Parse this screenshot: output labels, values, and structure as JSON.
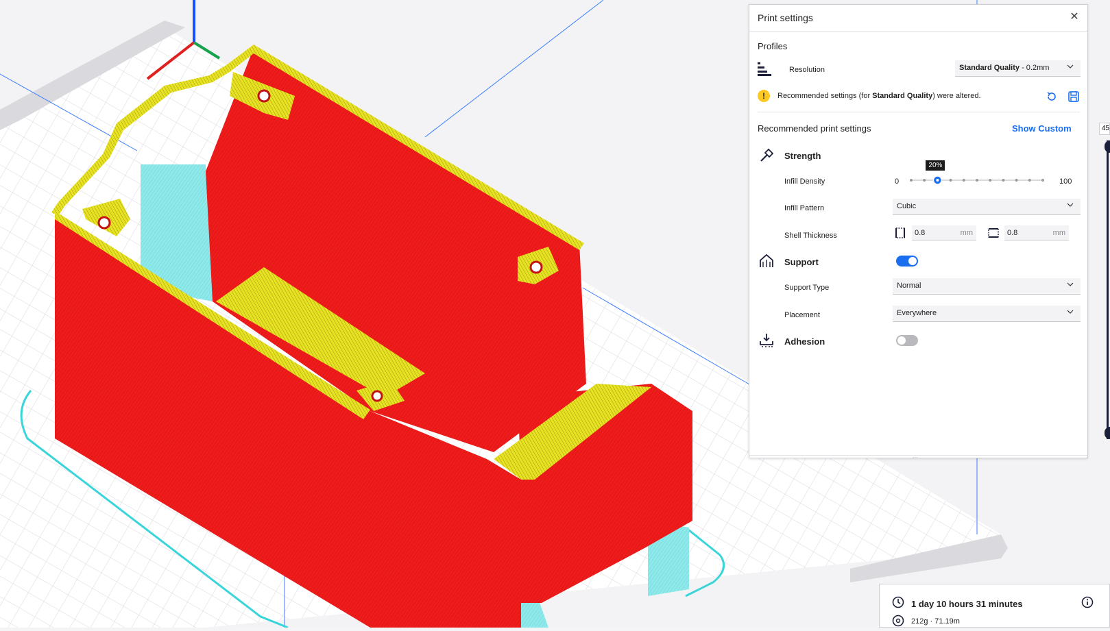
{
  "panel": {
    "title": "Print settings",
    "profiles_label": "Profiles",
    "resolution": {
      "label": "Resolution",
      "value_bold": "Standard Quality",
      "value_rest": " - 0.2mm"
    },
    "warning": {
      "prefix": "Recommended settings (for ",
      "profile": "Standard Quality",
      "suffix": ") were altered."
    },
    "recommended_label": "Recommended print settings",
    "show_custom": "Show Custom",
    "strength": {
      "label": "Strength",
      "infill_density_label": "Infill Density",
      "infill_min": "0",
      "infill_max": "100",
      "infill_value_label": "20%",
      "infill_value": 20,
      "infill_pattern_label": "Infill Pattern",
      "infill_pattern_value": "Cubic",
      "shell_label": "Shell Thickness",
      "wall_value": "0.8",
      "wall_unit": "mm",
      "topbottom_value": "0.8",
      "topbottom_unit": "mm"
    },
    "support": {
      "label": "Support",
      "enabled": true,
      "type_label": "Support Type",
      "type_value": "Normal",
      "placement_label": "Placement",
      "placement_value": "Everywhere"
    },
    "adhesion": {
      "label": "Adhesion",
      "enabled": false
    }
  },
  "summary": {
    "time": "1 day 10 hours 31 minutes",
    "material": "212g · 71.19m"
  },
  "layer_slider_value": "45",
  "colors": {
    "accent": "#196ef0",
    "warning": "#ffc924",
    "model_wall": "#ef1a1a",
    "model_infill": "#e8e322",
    "support": "#7fe6e6"
  }
}
